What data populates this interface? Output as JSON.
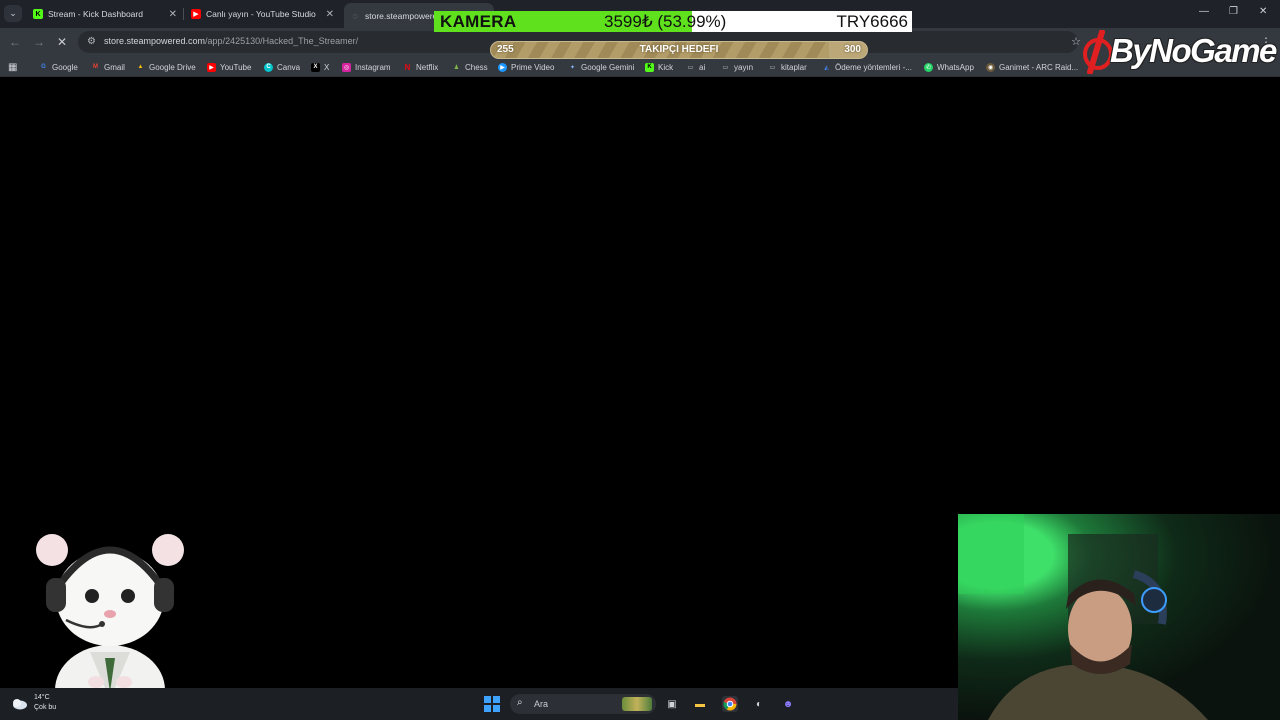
{
  "browser": {
    "tabs": [
      {
        "title": "Stream - Kick Dashboard",
        "icon": "kick-icon"
      },
      {
        "title": "Canlı yayın - YouTube Studio",
        "icon": "youtube-icon"
      },
      {
        "title": "store.steampowered",
        "icon": "loading-icon"
      }
    ],
    "address_url": "store.steampowered.com/app/2425130/Hacked_The_Streamer/",
    "address_host": "store.steampowered.com",
    "address_path": "/app/2425130/Hacked_The_Streamer/",
    "bookmarks": [
      {
        "label": "Google",
        "icon": "google-icon"
      },
      {
        "label": "Gmail",
        "icon": "gmail-icon"
      },
      {
        "label": "Google Drive",
        "icon": "drive-icon"
      },
      {
        "label": "YouTube",
        "icon": "youtube-icon"
      },
      {
        "label": "Canva",
        "icon": "canva-icon"
      },
      {
        "label": "X",
        "icon": "x-icon"
      },
      {
        "label": "Instagram",
        "icon": "instagram-icon"
      },
      {
        "label": "Netflix",
        "icon": "netflix-icon"
      },
      {
        "label": "Chess",
        "icon": "chess-icon"
      },
      {
        "label": "Prime Video",
        "icon": "prime-video-icon"
      },
      {
        "label": "Google Gemini",
        "icon": "gemini-icon"
      },
      {
        "label": "Kick",
        "icon": "kick-icon"
      },
      {
        "label": "ai",
        "icon": "folder-icon"
      },
      {
        "label": "yayın",
        "icon": "folder-icon"
      },
      {
        "label": "kitaplar",
        "icon": "folder-icon"
      },
      {
        "label": "Ödeme yöntemleri -...",
        "icon": "payment-icon"
      },
      {
        "label": "WhatsApp",
        "icon": "whatsapp-icon"
      },
      {
        "label": "Ganimet - ARC Raid...",
        "icon": "arc-raiders-icon"
      }
    ]
  },
  "overlay": {
    "kamera_label": "KAMERA",
    "kamera_amount": "3599₺ (53.99%)",
    "kamera_target": "TRY6666",
    "kamera_progress": 0.5399,
    "goal_title": "TAKIPÇI HEDEFI",
    "goal_start": "255",
    "goal_end": "300",
    "goal_progress": 0.9,
    "logo_text": "ByNoGame",
    "colors": {
      "kamera_fill": "#5fe11d",
      "goal_bar": "#bba777",
      "logo_mark": "#e02020"
    }
  },
  "taskbar": {
    "weather_temp": "14°C",
    "weather_desc": "Çok bu",
    "search_placeholder": "Ara"
  }
}
